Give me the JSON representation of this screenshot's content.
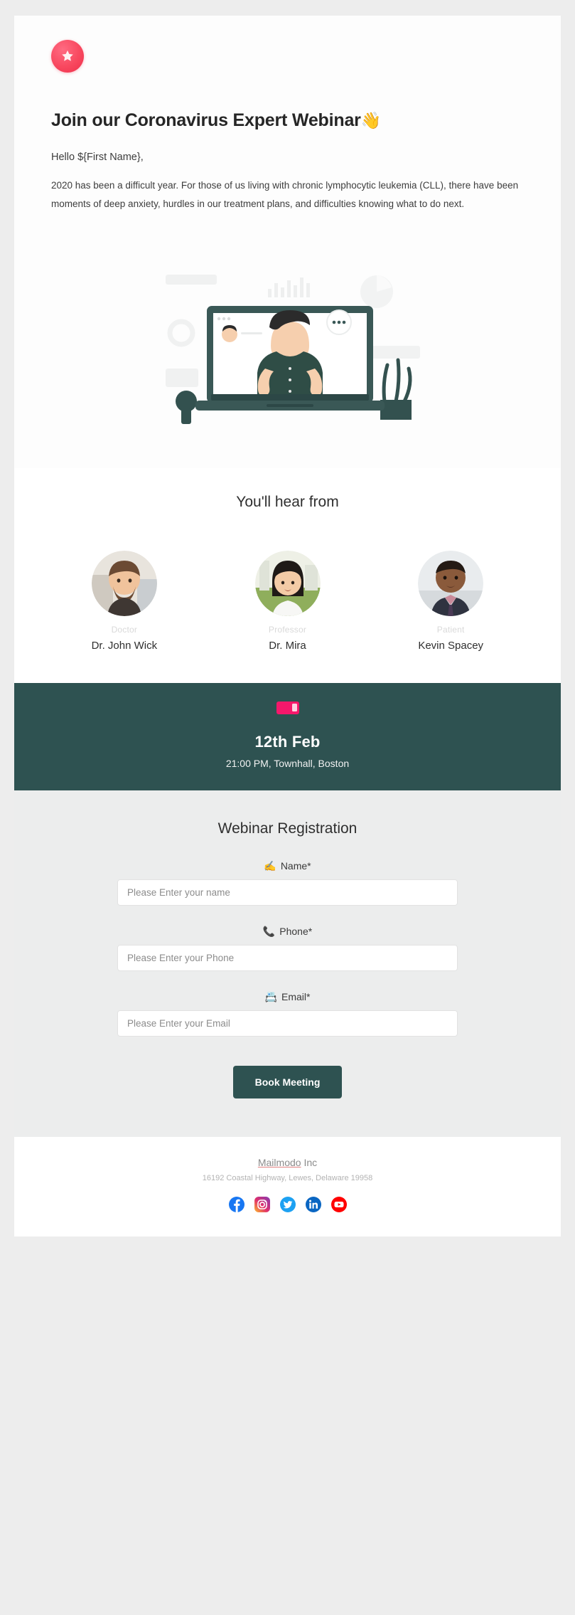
{
  "brand": {
    "logo_icon": "star-badge-icon",
    "accent_pink": "#f8485f",
    "accent_teal": "#2e5251"
  },
  "hero": {
    "title": "Join our Coronavirus Expert Webinar",
    "title_emoji": "👋",
    "greeting": "Hello ${First Name},",
    "body": "2020 has been a difficult year. For those of us living with chronic lymphocytic leukemia (CLL), there have been moments of deep anxiety, hurdles in our treatment plans, and difficulties knowing what to do next.",
    "illustration_name": "webinar-laptop-illustration"
  },
  "speakers_section": {
    "title": "You'll hear from",
    "speakers": [
      {
        "role": "Doctor",
        "name": "Dr. John Wick",
        "avatar": "speaker-avatar-1"
      },
      {
        "role": "Professor",
        "name": "Dr. Mira",
        "avatar": "speaker-avatar-2"
      },
      {
        "role": "Patient",
        "name": "Kevin Spacey",
        "avatar": "speaker-avatar-3"
      }
    ]
  },
  "event": {
    "badge_icon": "ticket-icon",
    "date": "12th Feb",
    "details": "21:00 PM, Townhall, Boston"
  },
  "form": {
    "title": "Webinar Registration",
    "fields": [
      {
        "icon": "✍️",
        "icon_name": "writing-hand-icon",
        "label": "Name*",
        "placeholder": "Please Enter your name",
        "value": ""
      },
      {
        "icon": "📞",
        "icon_name": "telephone-icon",
        "label": "Phone*",
        "placeholder": "Please Enter your Phone",
        "value": ""
      },
      {
        "icon": "📇",
        "icon_name": "email-card-icon",
        "label": "Email*",
        "placeholder": "Please Enter your Email",
        "value": ""
      }
    ],
    "submit_label": "Book Meeting"
  },
  "footer": {
    "company": "Mailmodo",
    "company_suffix": " Inc",
    "address": "16192 Coastal Highway, Lewes, Delaware 19958",
    "socials": [
      {
        "name": "facebook",
        "color": "#1877f2"
      },
      {
        "name": "instagram",
        "color": "#e1306c"
      },
      {
        "name": "twitter",
        "color": "#1da1f2"
      },
      {
        "name": "linkedin",
        "color": "#0a66c2"
      },
      {
        "name": "youtube",
        "color": "#ff0000"
      }
    ]
  }
}
